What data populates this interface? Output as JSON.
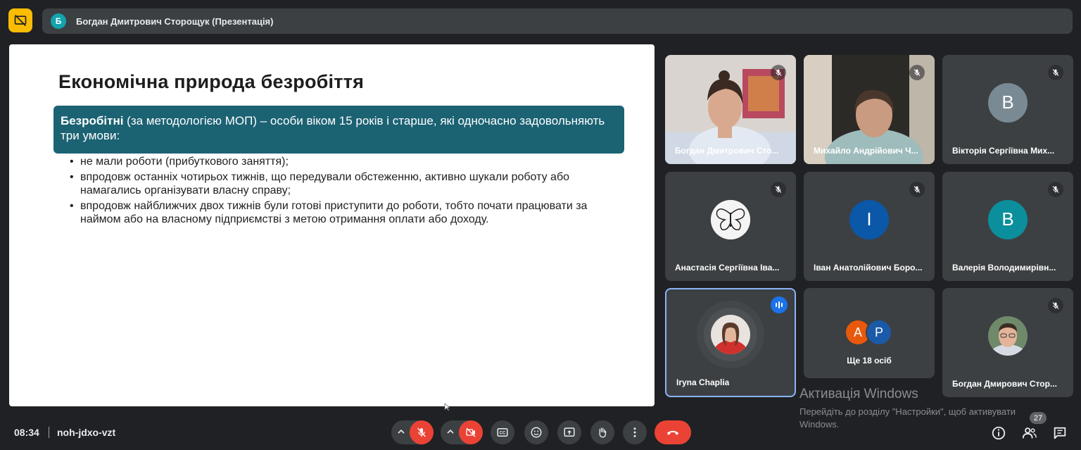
{
  "header": {
    "presenter_avatar_letter": "Б",
    "presenter_title": "Богдан Дмитрович Сторощук (Презентація)"
  },
  "slide": {
    "title": "Економічна природа безробіття",
    "definition_term": "Безробітні",
    "definition_rest": " (за методологією МОП) – особи віком 15 років і старше, які одночасно задовольняють три умови:",
    "bullets": [
      "не мали роботи (прибуткового заняття);",
      "впродовж останніх чотирьох тижнів, що передували обстеженню, активно шукали роботу або намагались організувати власну справу;",
      "впродовж найближчих двох тижнів були готові приступити до роботи, тобто почати працювати за наймом або на власному підприємстві з метою отримання оплати або доходу."
    ]
  },
  "participants": [
    {
      "name": "Богдан Дмитрович Сто...",
      "type": "video"
    },
    {
      "name": "Михайло Андрійович Ч...",
      "type": "video"
    },
    {
      "name": "Вікторія Сергіївна Мих...",
      "letter": "В",
      "color": "#7a8a94"
    },
    {
      "name": "Анастасія Сергіївна Іва...",
      "type": "photo"
    },
    {
      "name": "Іван Анатолійович Боро...",
      "letter": "І",
      "color": "#0b57a8"
    },
    {
      "name": "Валерія Володимирівн...",
      "letter": "В",
      "color": "#0b8f9c"
    },
    {
      "name": "Iryna Chaplia",
      "type": "photo",
      "speaking": true
    },
    {
      "name": "Ще 18 осіб",
      "letters": [
        "А",
        "Р"
      ]
    },
    {
      "name": "Богдан Дмирович Стор...",
      "type": "photo"
    }
  ],
  "watermark": {
    "title": "Активація Windows",
    "subtitle": "Перейдіть до розділу \"Настройки\", щоб активувати Windows."
  },
  "footer": {
    "time": "08:34",
    "meeting_code": "noh-jdxo-vzt",
    "participant_count": "27"
  },
  "colors": {
    "background": "#202124",
    "tile": "#3c4043",
    "accent_present": "#fbbc04",
    "slide_box": "#1b6273",
    "danger": "#ea4335",
    "active_border": "#8ab4f8"
  }
}
